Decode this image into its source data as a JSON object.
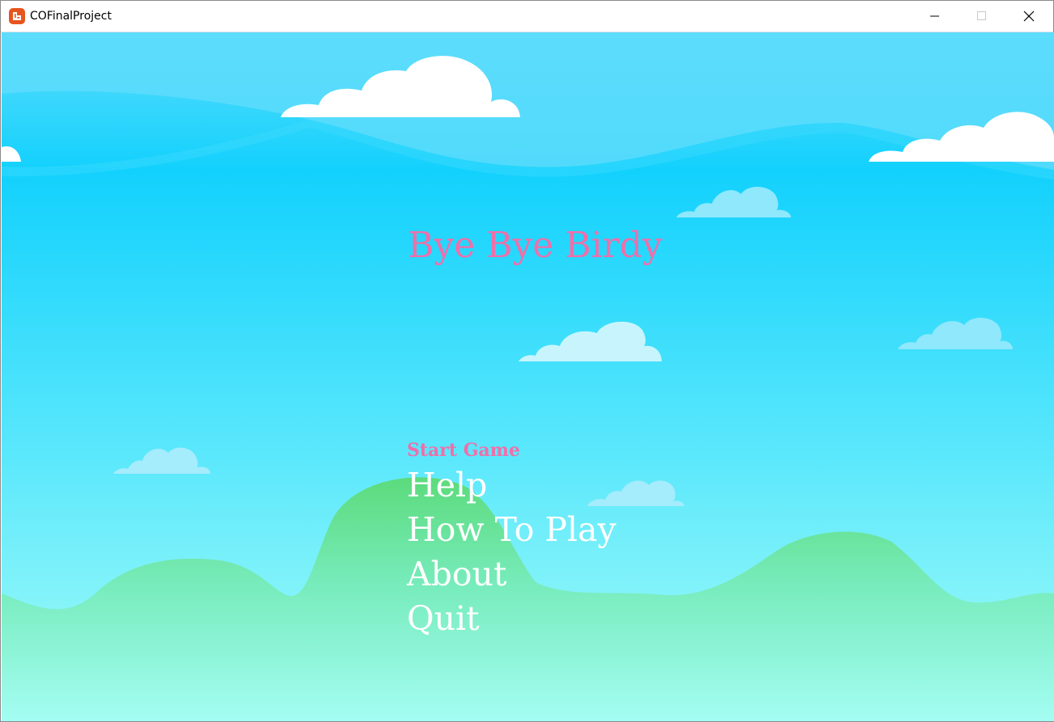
{
  "window": {
    "title": "COFinalProject",
    "app_icon": "monogame-icon",
    "controls": [
      "minimize-icon",
      "maximize-icon",
      "close-icon"
    ]
  },
  "game": {
    "title": "Bye Bye Birdy",
    "menu": [
      {
        "id": "start",
        "label": "Start Game",
        "selected": true
      },
      {
        "id": "help",
        "label": "Help",
        "selected": false
      },
      {
        "id": "how-to-play",
        "label": "How To Play",
        "selected": false
      },
      {
        "id": "about",
        "label": "About",
        "selected": false
      },
      {
        "id": "quit",
        "label": "Quit",
        "selected": false
      }
    ]
  },
  "colors": {
    "sky_top": "#5fdcfb",
    "sky_mid": "#1ad2fd",
    "sky_bottom": "#a3fbf6",
    "hills": "#5fdd7e",
    "title_pink": "#f06fa9",
    "menu_white": "#ffffff",
    "app_icon": "#e7541e"
  }
}
